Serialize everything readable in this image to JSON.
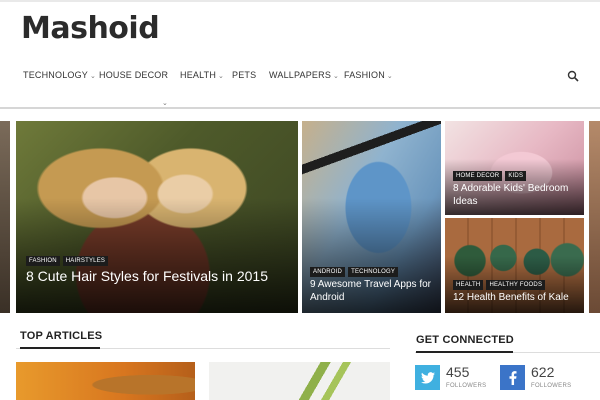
{
  "site": {
    "logo": "Mashoid"
  },
  "nav": {
    "items": [
      {
        "label": "TECHNOLOGY",
        "has_dropdown": true
      },
      {
        "label": "HOUSE DECOR",
        "has_dropdown": false
      },
      {
        "label": "HEALTH",
        "has_dropdown": true
      },
      {
        "label": "PETS",
        "has_dropdown": false
      },
      {
        "label": "WALLPAPERS",
        "has_dropdown": true
      },
      {
        "label": "FASHION",
        "has_dropdown": true
      }
    ],
    "search_icon": "search-icon"
  },
  "slider": {
    "featured": {
      "tags": [
        "FASHION",
        "HAIRSTYLES"
      ],
      "title": "8 Cute Hair Styles for Festivals in 2015"
    },
    "travel": {
      "tags": [
        "ANDROID",
        "TECHNOLOGY"
      ],
      "title": "9 Awesome Travel Apps for Android"
    },
    "bedroom": {
      "tags": [
        "HOME DECOR",
        "KIDS"
      ],
      "title": "8 Adorable Kids' Bedroom Ideas"
    },
    "kale": {
      "tags": [
        "HEALTH",
        "HEALTHY FOODS"
      ],
      "title": "12 Health Benefits of Kale"
    }
  },
  "top_articles": {
    "heading": "TOP ARTICLES"
  },
  "get_connected": {
    "heading": "GET CONNECTED",
    "twitter": {
      "count": "455",
      "label": "FOLLOWERS",
      "color": "#3fb0e0",
      "icon": "twitter-icon"
    },
    "facebook": {
      "count": "622",
      "label": "FOLLOWERS",
      "color": "#3b74c8",
      "icon": "facebook-icon"
    }
  }
}
